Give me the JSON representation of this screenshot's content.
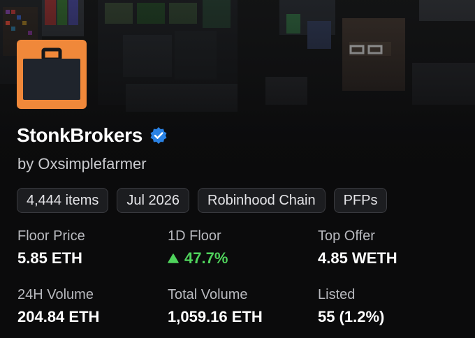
{
  "collection": {
    "name": "StonkBrokers",
    "creator": "by Oxsimplefarmer",
    "verified": true,
    "avatar_icon": "briefcase-icon",
    "avatar_color": "#f0883a"
  },
  "chips": [
    {
      "label": "4,444 items"
    },
    {
      "label": "Jul 2026"
    },
    {
      "label": "Robinhood Chain"
    },
    {
      "label": "PFPs"
    }
  ],
  "stats": [
    {
      "label": "Floor Price",
      "value": "5.85 ETH"
    },
    {
      "label": "1D Floor",
      "value": "47.7%",
      "trend": "up",
      "trend_color": "#4fd35c"
    },
    {
      "label": "Top Offer",
      "value": "4.85 WETH"
    },
    {
      "label": "24H Volume",
      "value": "204.84 ETH"
    },
    {
      "label": "Total Volume",
      "value": "1,059.16 ETH"
    },
    {
      "label": "Listed",
      "value": "55 (1.2%)"
    }
  ]
}
